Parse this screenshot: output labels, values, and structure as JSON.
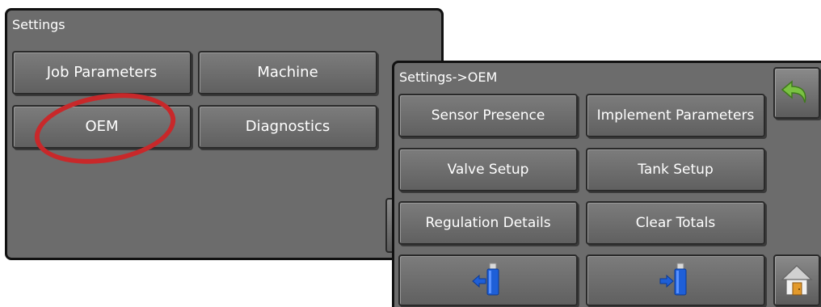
{
  "settings_panel": {
    "title": "Settings",
    "buttons": {
      "job_parameters": "Job Parameters",
      "machine": "Machine",
      "oem": "OEM",
      "diagnostics": "Diagnostics"
    },
    "highlight_color": "#c8282a"
  },
  "oem_panel": {
    "title": "Settings->OEM",
    "buttons": {
      "sensor_presence": "Sensor Presence",
      "implement_parameters": "Implement Parameters",
      "valve_setup": "Valve Setup",
      "tank_setup": "Tank Setup",
      "regulation_details": "Regulation Details",
      "clear_totals": "Clear Totals"
    },
    "icons": {
      "back": "back-arrow-icon",
      "home": "home-icon",
      "usb_import": "usb-import-icon",
      "usb_export": "usb-export-icon"
    }
  },
  "colors": {
    "panel_bg": "#6c6c6c",
    "back_arrow": "#7ac142",
    "usb_blue": "#1e5fd8"
  }
}
